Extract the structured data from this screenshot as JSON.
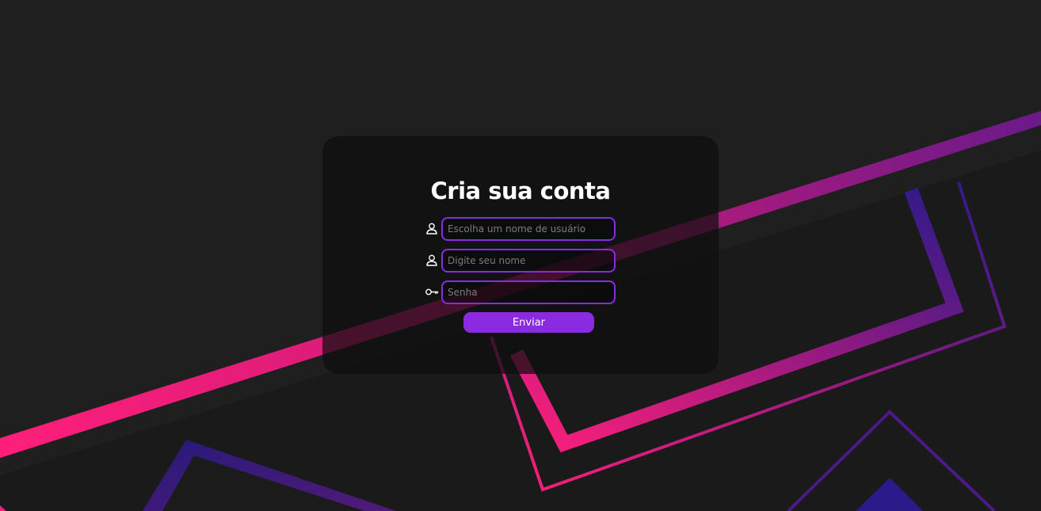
{
  "form": {
    "title": "Cria sua conta",
    "fields": [
      {
        "placeholder": "Escolha um nome de usuário",
        "value": "",
        "icon": "user-icon"
      },
      {
        "placeholder": "Digite seu nome",
        "value": "",
        "icon": "user-icon"
      },
      {
        "placeholder": "Senha",
        "value": "",
        "icon": "key-icon"
      }
    ],
    "submit_label": "Enviar"
  },
  "colors": {
    "background": "#1f1f1f",
    "card": "#0e0e0e",
    "accent": "#8a2be2",
    "pink": "#ff1f7a",
    "navy": "#241a7a"
  }
}
